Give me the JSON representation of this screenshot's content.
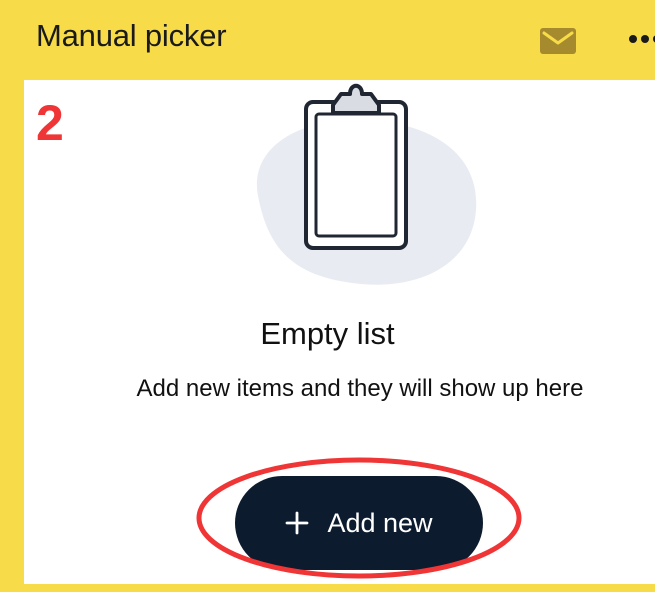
{
  "header": {
    "title": "Manual picker",
    "mail_icon": "mail-icon",
    "more_icon": "more-horizontal-icon"
  },
  "step": {
    "number": "2"
  },
  "empty_state": {
    "illustration_icon": "clipboard-icon",
    "title": "Empty list",
    "description": "Add new items and they will show up here"
  },
  "action": {
    "label": "Add new",
    "icon": "plus-icon"
  },
  "colors": {
    "header_background": "#f7db48",
    "button_background": "#0d1b2e",
    "annotation": "#ef3535",
    "illustration_blob": "#e8ecf2"
  }
}
